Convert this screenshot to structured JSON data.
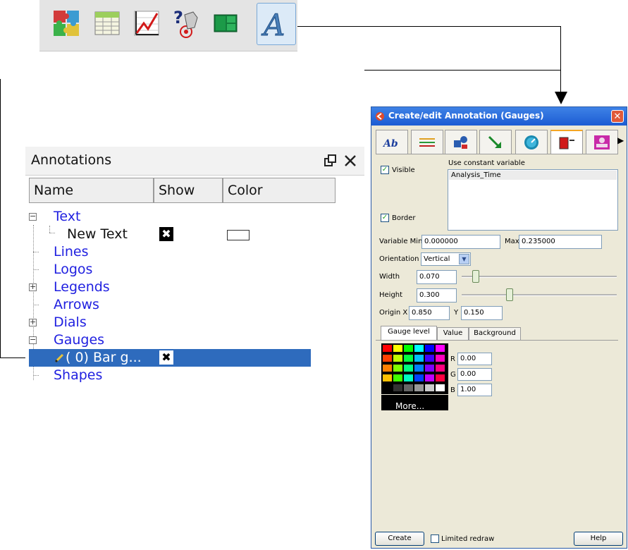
{
  "toolbar": {
    "icons": [
      "plugins-icon",
      "spreadsheet-icon",
      "chart-icon",
      "query-icon",
      "layout-icon",
      "annotation-icon"
    ]
  },
  "annotations_panel": {
    "title": "Annotations",
    "columns": [
      "Name",
      "Show",
      "Color"
    ],
    "tree": {
      "text": "Text",
      "new_text": "New Text",
      "lines": "Lines",
      "logos": "Logos",
      "legends": "Legends",
      "arrows": "Arrows",
      "dials": "Dials",
      "gauges": "Gauges",
      "bar_gauge": "( 0) Bar g...",
      "shapes": "Shapes"
    },
    "expander_minus": "−",
    "expander_plus": "+",
    "check_mark": "✖",
    "selected_color": "#2e6bbd"
  },
  "dialog": {
    "title": "Create/edit Annotation (Gauges)",
    "close_label": "✕",
    "tabs_more": "▶",
    "visible_label": "Visible",
    "border_label": "Border",
    "use_constant_label": "Use constant variable",
    "variable_item": "Analysis_Time",
    "variable_min_label": "Variable Min",
    "variable_min_value": "0.000000",
    "max_label": "Max",
    "max_value": "0.235000",
    "orientation_label": "Orientation",
    "orientation_value": "Vertical",
    "width_label": "Width",
    "width_value": "0.070",
    "height_label": "Height",
    "height_value": "0.300",
    "origin_x_label": "Origin X",
    "origin_x_value": "0.850",
    "y_label": "Y",
    "y_value": "0.150",
    "subtabs": [
      "Gauge level",
      "Value",
      "Background"
    ],
    "r_label": "R",
    "r_value": "0.00",
    "g_label": "G",
    "g_value": "0.00",
    "b_label": "B",
    "b_value": "1.00",
    "more_label": "More...",
    "create_label": "Create",
    "limited_redraw_label": "Limited redraw",
    "help_label": "Help",
    "title_color": "#1c5cd3"
  }
}
